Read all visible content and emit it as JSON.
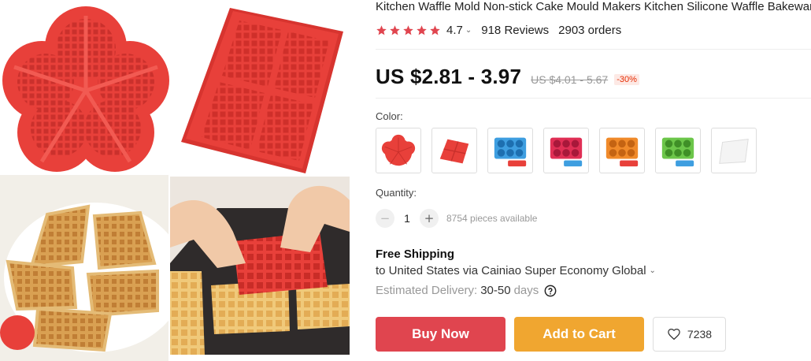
{
  "product": {
    "title": "Kitchen Waffle Mold Non-stick Cake Mould Makers Kitchen Silicone Waffle Bakeware",
    "rating": "4.7",
    "reviews": "918 Reviews",
    "orders": "2903 orders"
  },
  "price": {
    "current": "US $2.81 - 3.97",
    "original": "US $4.01 - 5.67",
    "discount": "-30%"
  },
  "color": {
    "label": "Color:",
    "options": [
      "red-heart-mold",
      "red-rectangle-mold",
      "blue-donut-mold",
      "rose-donut-mold",
      "orange-donut-mold",
      "green-donut-mold",
      "white-plate"
    ]
  },
  "quantity": {
    "label": "Quantity:",
    "value": "1",
    "available": "8754 pieces available"
  },
  "shipping": {
    "title": "Free Shipping",
    "destination": "to United States via Cainiao Super Economy Global",
    "delivery_label": "Estimated Delivery:",
    "delivery_days": "30-50",
    "delivery_unit": "days"
  },
  "actions": {
    "buy_now": "Buy Now",
    "add_to_cart": "Add to Cart",
    "wishlist_count": "7238"
  },
  "icons": {
    "star": "star-icon",
    "chevron": "chevron-down-icon",
    "help": "question-circle-icon",
    "heart": "heart-icon"
  },
  "colors": {
    "mold_red": "#e8403a",
    "buy_now": "#e0454f",
    "add_to_cart": "#f0a630",
    "star": "#e0454f",
    "discount_text": "#e62e04"
  }
}
